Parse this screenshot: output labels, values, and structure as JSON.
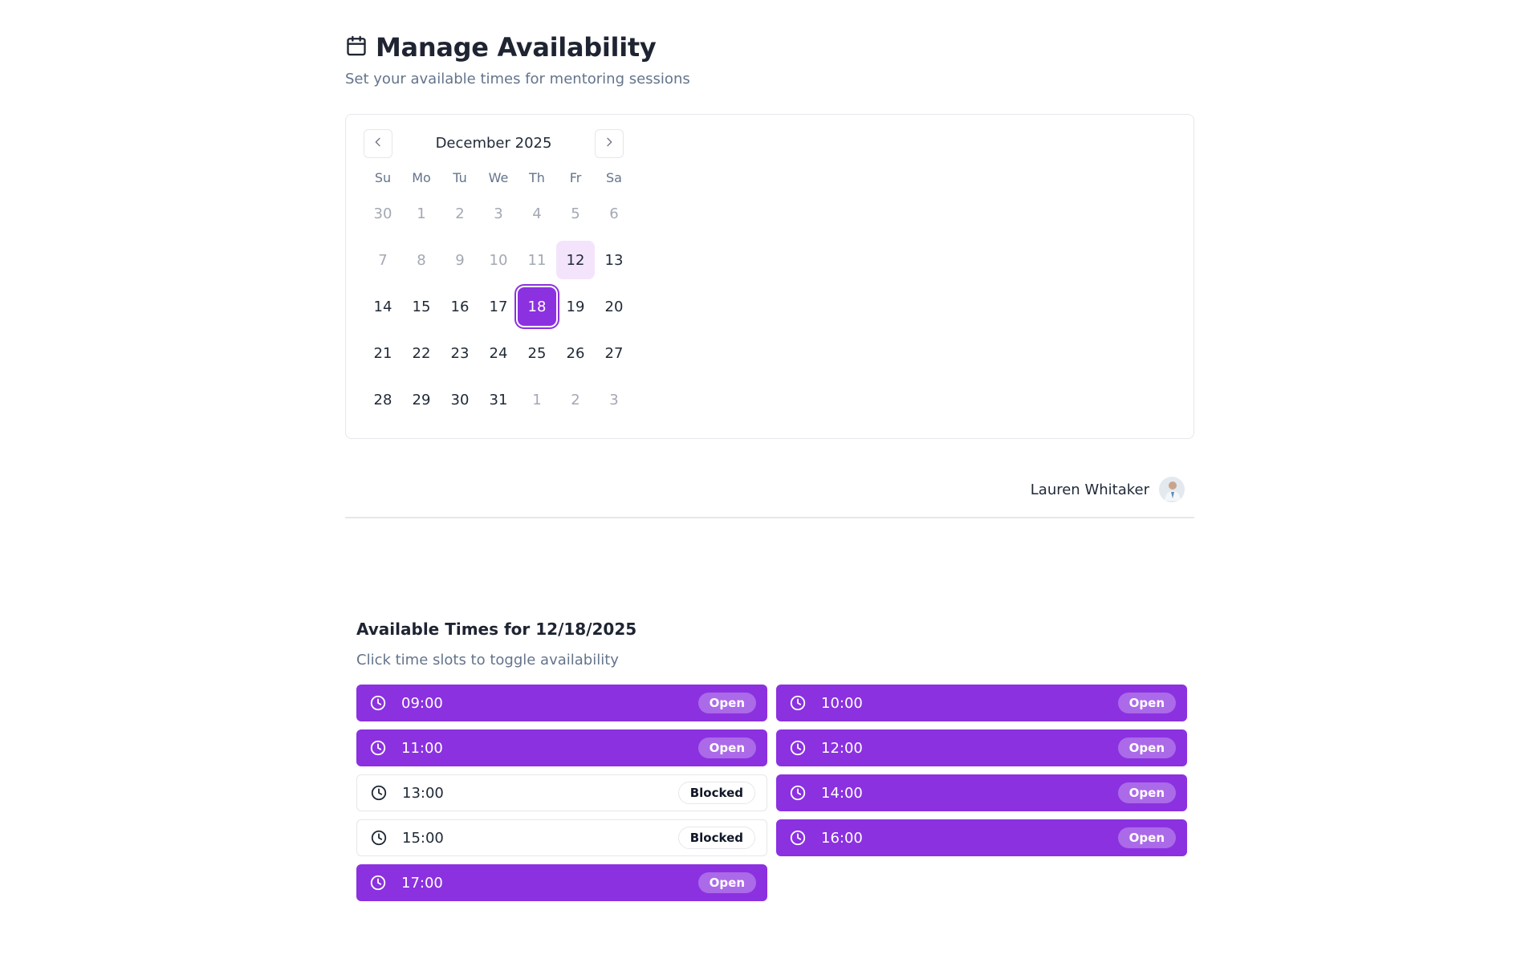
{
  "header": {
    "title": "Manage Availability",
    "subtitle": "Set your available times for mentoring sessions"
  },
  "calendar": {
    "month_label": "December 2025",
    "weekdays": [
      "Su",
      "Mo",
      "Tu",
      "We",
      "Th",
      "Fr",
      "Sa"
    ],
    "weeks": [
      [
        {
          "d": "30",
          "muted": true
        },
        {
          "d": "1",
          "muted": true
        },
        {
          "d": "2",
          "muted": true
        },
        {
          "d": "3",
          "muted": true
        },
        {
          "d": "4",
          "muted": true
        },
        {
          "d": "5",
          "muted": true
        },
        {
          "d": "6",
          "muted": true
        }
      ],
      [
        {
          "d": "7",
          "muted": true
        },
        {
          "d": "8",
          "muted": true
        },
        {
          "d": "9",
          "muted": true
        },
        {
          "d": "10",
          "muted": true
        },
        {
          "d": "11",
          "muted": true
        },
        {
          "d": "12",
          "today": true
        },
        {
          "d": "13"
        }
      ],
      [
        {
          "d": "14"
        },
        {
          "d": "15"
        },
        {
          "d": "16"
        },
        {
          "d": "17"
        },
        {
          "d": "18",
          "selected": true
        },
        {
          "d": "19"
        },
        {
          "d": "20"
        }
      ],
      [
        {
          "d": "21"
        },
        {
          "d": "22"
        },
        {
          "d": "23"
        },
        {
          "d": "24"
        },
        {
          "d": "25"
        },
        {
          "d": "26"
        },
        {
          "d": "27"
        }
      ],
      [
        {
          "d": "28"
        },
        {
          "d": "29"
        },
        {
          "d": "30"
        },
        {
          "d": "31"
        },
        {
          "d": "1",
          "muted": true
        },
        {
          "d": "2",
          "muted": true
        },
        {
          "d": "3",
          "muted": true
        }
      ]
    ]
  },
  "user": {
    "name": "Lauren Whitaker"
  },
  "slots_section": {
    "title": "Available Times for 12/18/2025",
    "subtitle": "Click time slots to toggle availability",
    "slots": [
      {
        "time": "09:00",
        "status": "Open"
      },
      {
        "time": "10:00",
        "status": "Open"
      },
      {
        "time": "11:00",
        "status": "Open"
      },
      {
        "time": "12:00",
        "status": "Open"
      },
      {
        "time": "13:00",
        "status": "Blocked"
      },
      {
        "time": "14:00",
        "status": "Open"
      },
      {
        "time": "15:00",
        "status": "Blocked"
      },
      {
        "time": "16:00",
        "status": "Open"
      },
      {
        "time": "17:00",
        "status": "Open"
      }
    ]
  },
  "colors": {
    "accent": "#8b31e0",
    "today_bg": "#f3e4fb",
    "muted_text": "#64748b",
    "border": "#e5e7eb"
  },
  "icons": {
    "title": "calendar-icon",
    "prev": "chevron-left-icon",
    "next": "chevron-right-icon",
    "slot": "clock-icon"
  }
}
